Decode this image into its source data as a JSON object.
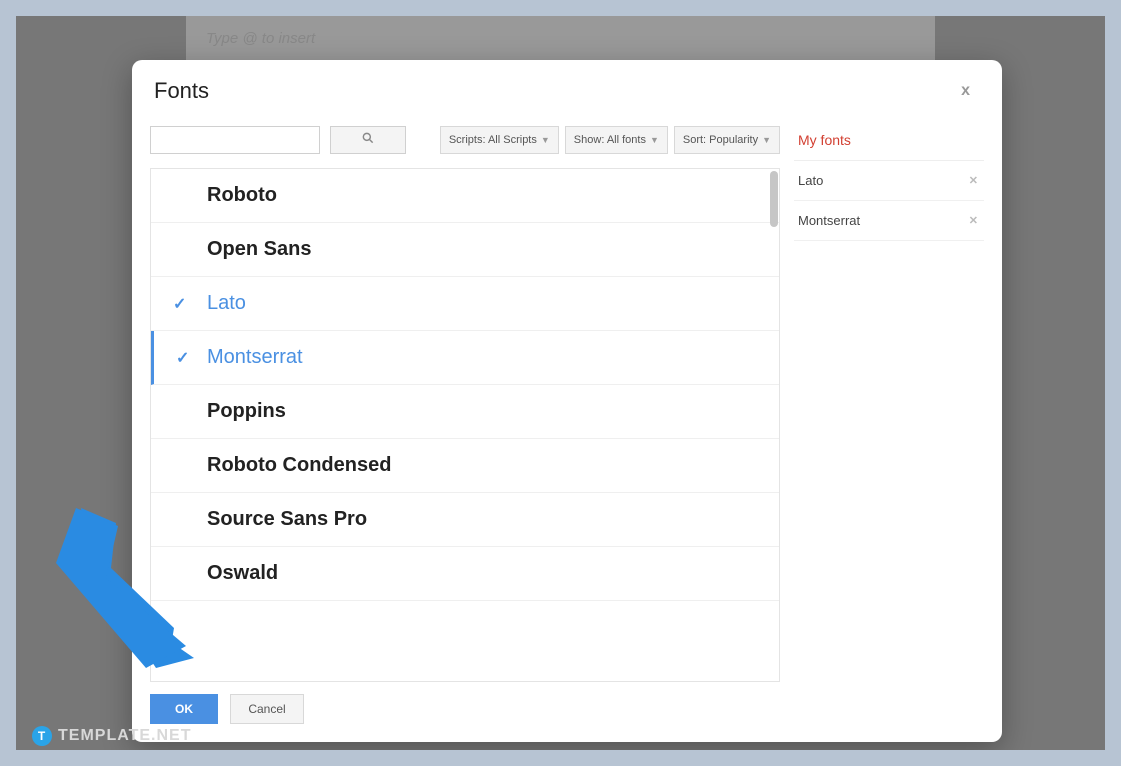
{
  "background": {
    "placeholder": "Type @ to insert"
  },
  "dialog": {
    "title": "Fonts",
    "close": "x",
    "search": {
      "value": ""
    },
    "filters": {
      "scripts": "Scripts: All Scripts",
      "show": "Show: All fonts",
      "sort": "Sort: Popularity"
    },
    "fonts": [
      {
        "name": "Roboto",
        "selected": false,
        "current": false
      },
      {
        "name": "Open Sans",
        "selected": false,
        "current": false
      },
      {
        "name": "Lato",
        "selected": true,
        "current": false
      },
      {
        "name": "Montserrat",
        "selected": true,
        "current": true
      },
      {
        "name": "Poppins",
        "selected": false,
        "current": false
      },
      {
        "name": "Roboto Condensed",
        "selected": false,
        "current": false
      },
      {
        "name": "Source Sans Pro",
        "selected": false,
        "current": false
      },
      {
        "name": "Oswald",
        "selected": false,
        "current": false
      }
    ],
    "my_fonts": {
      "title": "My fonts",
      "items": [
        {
          "name": "Lato"
        },
        {
          "name": "Montserrat"
        }
      ]
    },
    "buttons": {
      "ok": "OK",
      "cancel": "Cancel"
    }
  },
  "watermark": {
    "badge": "T",
    "text": "TEMPLATE.NET"
  }
}
